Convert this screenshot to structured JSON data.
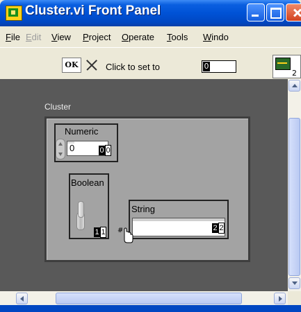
{
  "window": {
    "title": "Cluster.vi Front Panel"
  },
  "menu": {
    "items": [
      {
        "label": "File",
        "accel": "F",
        "rest": "ile",
        "enabled": true
      },
      {
        "label": "Edit",
        "accel": "E",
        "rest": "dit",
        "enabled": false
      },
      {
        "label": "View",
        "accel": "V",
        "rest": "iew",
        "enabled": true
      },
      {
        "label": "Project",
        "accel": "P",
        "rest": "roject",
        "enabled": true
      },
      {
        "label": "Operate",
        "accel": "O",
        "rest": "perate",
        "enabled": true
      },
      {
        "label": "Tools",
        "accel": "T",
        "rest": "ools",
        "enabled": true
      },
      {
        "label": "Windo",
        "accel": "W",
        "rest": "indo",
        "enabled": true
      }
    ]
  },
  "toolbar": {
    "ok_label": "OK",
    "click_to_set_label": "Click to set to",
    "set_value": "0",
    "vi_icon_number": "2"
  },
  "panel": {
    "cluster_label": "Cluster",
    "numeric": {
      "label": "Numeric",
      "value": "0",
      "tab_index_black": "0",
      "tab_index_white": "0"
    },
    "boolean": {
      "label": "Boolean",
      "tab_index_black": "1",
      "tab_index_white": "1"
    },
    "string": {
      "label": "String",
      "value": "",
      "tab_index_black": "2",
      "tab_index_white": "2"
    }
  },
  "colors": {
    "panel_bg": "#595959",
    "cluster_bg": "#a3a3a3",
    "titlebar": "#0052d6"
  }
}
